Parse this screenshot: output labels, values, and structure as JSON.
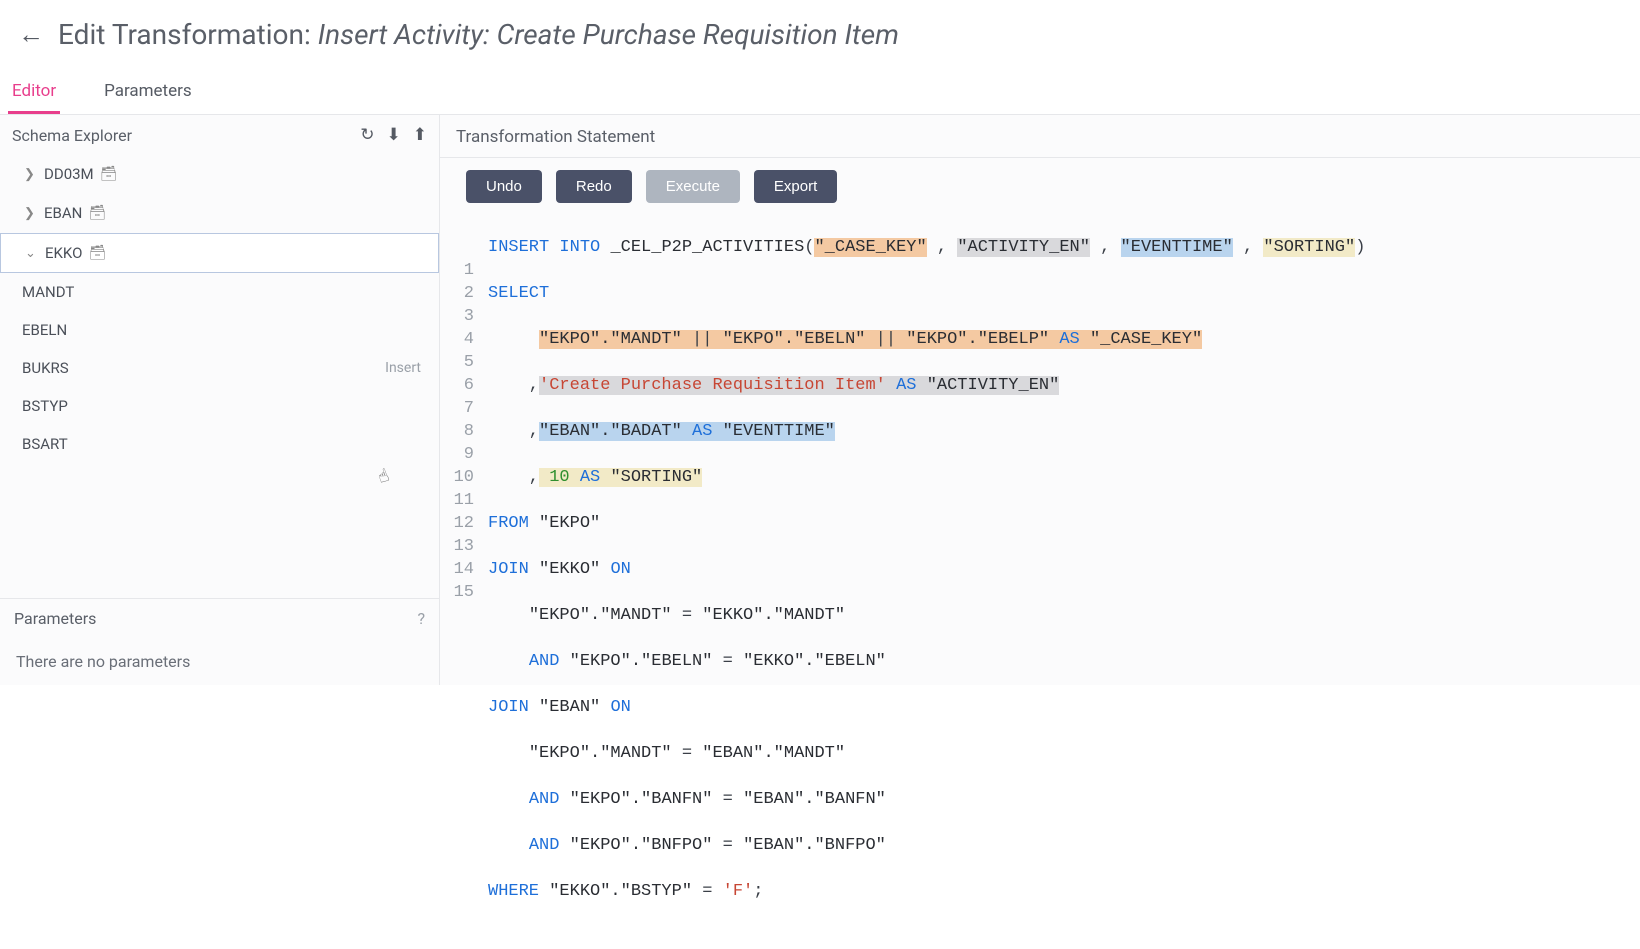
{
  "header": {
    "prefix": "Edit Transformation: ",
    "italic": "Insert Activity: Create Purchase Requisition Item"
  },
  "tabs": {
    "editor": "Editor",
    "parameters": "Parameters"
  },
  "schema": {
    "title": "Schema Explorer",
    "tables": [
      {
        "name": "DD03M",
        "expanded": false
      },
      {
        "name": "EBAN",
        "expanded": false
      },
      {
        "name": "EKKO",
        "expanded": true,
        "columns": [
          "MANDT",
          "EBELN",
          "BUKRS",
          "BSTYP",
          "BSART"
        ]
      }
    ],
    "insert_label": "Insert"
  },
  "parameters_panel": {
    "title": "Parameters",
    "help": "?",
    "empty": "There are no parameters"
  },
  "editor": {
    "title": "Transformation Statement",
    "buttons": {
      "undo": "Undo",
      "redo": "Redo",
      "execute": "Execute",
      "export": "Export"
    }
  },
  "sql": {
    "activities_table": "_CEL_P2P_ACTIVITIES",
    "cols": {
      "case_key": "\"_CASE_KEY\"",
      "activity": "\"ACTIVITY_EN\"",
      "eventtime": "\"EVENTTIME\"",
      "sorting": "\"SORTING\""
    },
    "activity_literal": "'Create Purchase Requisition Item'",
    "sorting_value": "10",
    "from_table": "\"EKPO\"",
    "join1_table": "\"EKKO\"",
    "join2_table": "\"EBAN\"",
    "where_col": "\"EKKO\".\"BSTYP\"",
    "where_val": "'F'",
    "concat": {
      "p1": "\"EKPO\".\"MANDT\"",
      "p2": "\"EKPO\".\"EBELN\"",
      "p3": "\"EKPO\".\"EBELP\""
    },
    "eventtime_src": "\"EBAN\".\"BADAT\"",
    "j1a_l": "\"EKPO\".\"MANDT\"",
    "j1a_r": "\"EKKO\".\"MANDT\"",
    "j1b_l": "\"EKPO\".\"EBELN\"",
    "j1b_r": "\"EKKO\".\"EBELN\"",
    "j2a_l": "\"EKPO\".\"MANDT\"",
    "j2a_r": "\"EBAN\".\"MANDT\"",
    "j2b_l": "\"EKPO\".\"BANFN\"",
    "j2b_r": "\"EBAN\".\"BANFN\"",
    "j2c_l": "\"EKPO\".\"BNFPO\"",
    "j2c_r": "\"EBAN\".\"BNFPO\""
  }
}
